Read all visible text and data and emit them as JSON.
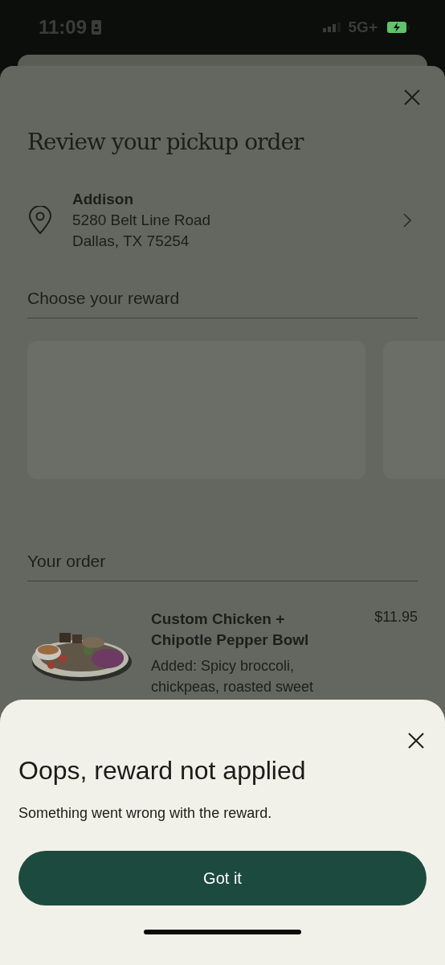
{
  "status_bar": {
    "time": "11:09",
    "network": "5G+"
  },
  "order_review": {
    "title": "Review your pickup order",
    "location": {
      "name": "Addison",
      "address_line_1": "5280 Belt Line Road",
      "address_line_2": "Dallas, TX 75254"
    },
    "reward_section": {
      "heading": "Choose your reward"
    },
    "order_section": {
      "heading": "Your order",
      "items": [
        {
          "name": "Custom Chicken + Chipotle Pepper Bowl",
          "price": "$11.95",
          "details": "Added: Spicy broccoli, chickpeas, roasted sweet"
        }
      ]
    }
  },
  "alert_sheet": {
    "title": "Oops, reward not applied",
    "message": "Something went wrong with the reward.",
    "button": "Got it"
  }
}
